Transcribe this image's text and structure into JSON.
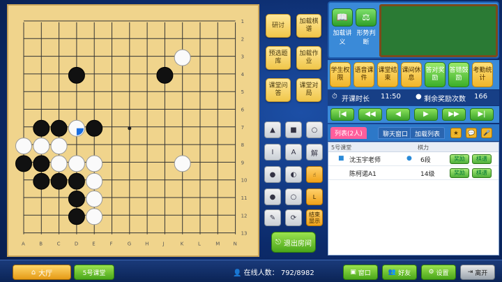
{
  "board": {
    "size": 13,
    "col_labels": [
      "A",
      "B",
      "C",
      "D",
      "E",
      "F",
      "G",
      "H",
      "J",
      "K",
      "L",
      "M",
      "N"
    ],
    "row_labels": [
      "1",
      "2",
      "3",
      "4",
      "5",
      "6",
      "7",
      "8",
      "9",
      "10",
      "11",
      "12",
      "13"
    ],
    "black_stones": [
      [
        "D",
        4
      ],
      [
        "J",
        4
      ],
      [
        "B",
        7
      ],
      [
        "C",
        7
      ],
      [
        "E",
        7
      ],
      [
        "A",
        9
      ],
      [
        "B",
        9
      ],
      [
        "B",
        10
      ],
      [
        "C",
        10
      ],
      [
        "D",
        10
      ],
      [
        "D",
        11
      ],
      [
        "D",
        12
      ]
    ],
    "white_stones": [
      [
        "K",
        3
      ],
      [
        "D",
        7
      ],
      [
        "A",
        8
      ],
      [
        "B",
        8
      ],
      [
        "C,8",
        0
      ],
      [
        "C",
        8
      ],
      [
        "C",
        9
      ],
      [
        "D",
        9
      ],
      [
        "E",
        9
      ],
      [
        "K",
        9
      ],
      [
        "E",
        10
      ],
      [
        "E",
        11
      ],
      [
        "E",
        12
      ]
    ],
    "last_move": [
      "D",
      7
    ]
  },
  "tools": {
    "research": "研讨",
    "load_board": "加载棋谱",
    "preview_problem": "预选题库",
    "load_homework": "加载作业",
    "class_question": "课堂问答",
    "class_match": "课堂对局",
    "solve": "解",
    "exit_room": "退出房间"
  },
  "top": {
    "load_lecture": "加载讲义",
    "situation_judge": "形势判断"
  },
  "status_buttons": [
    "学生权限",
    "语音课件",
    "课堂结束",
    "课间休息",
    "答对奖励",
    "答错鼓励",
    "考勤统计"
  ],
  "stats": {
    "class_time_label": "开课时长",
    "class_time_value": "11:50",
    "reward_label": "剩余奖励次数",
    "reward_value": "166"
  },
  "tabs": {
    "list": "列表(2人)",
    "chat": "聊天窗口",
    "load_list": "加载列表"
  },
  "list": {
    "col_class": "5号课堂",
    "col_rank": "棋力",
    "rows": [
      {
        "name": "沈玉宇老师",
        "rank": "6段",
        "reward": "奖励",
        "board": "棋谱"
      },
      {
        "name": "陈柯诺A1",
        "rank": "14级",
        "reward": "奖励",
        "board": "棋谱"
      }
    ]
  },
  "bottom": {
    "hall": "大厅",
    "room": "5号课堂",
    "online_label": "在线人数：",
    "online_value": "792/8982",
    "window": "窗口",
    "friends": "好友",
    "settings": "设置",
    "leave": "离开"
  }
}
